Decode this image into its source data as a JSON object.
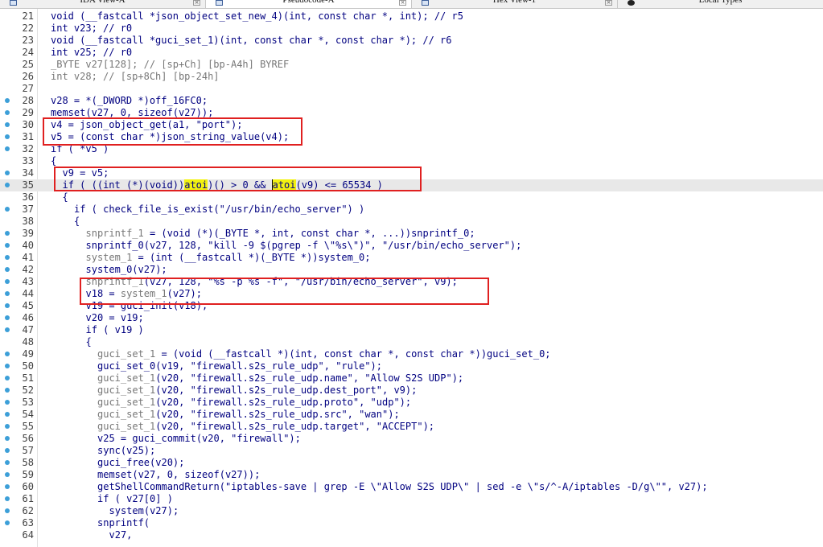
{
  "tabs": [
    {
      "label": "IDA View-A",
      "icon": "ida-view-icon",
      "active": false
    },
    {
      "label": "Pseudocode-A",
      "icon": "pseudocode-icon",
      "active": true
    },
    {
      "label": "Hex View-1",
      "icon": "hex-view-icon",
      "active": false
    },
    {
      "label": "Local Types",
      "icon": "local-types-icon",
      "active": false
    }
  ],
  "colors": {
    "highlight_box": "#e02020",
    "breakpoint_dot": "#3c9fd8",
    "text": "#000080",
    "grey": "#777777",
    "search_highlight": "#f2f210"
  },
  "lines": [
    {
      "num": "21",
      "bp": false,
      "indent": 0,
      "parts": [
        [
          "c",
          "void (__fastcall *json_object_set_new_4)(int, const char *, int); // r5"
        ]
      ]
    },
    {
      "num": "22",
      "bp": false,
      "indent": 0,
      "parts": [
        [
          "c",
          "int v23; // r0"
        ]
      ]
    },
    {
      "num": "23",
      "bp": false,
      "indent": 0,
      "parts": [
        [
          "c",
          "void (__fastcall *guci_set_1)(int, const char *, const char *); // r6"
        ]
      ]
    },
    {
      "num": "24",
      "bp": false,
      "indent": 0,
      "parts": [
        [
          "c",
          "int v25; // r0"
        ]
      ]
    },
    {
      "num": "25",
      "bp": false,
      "indent": 0,
      "parts": [
        [
          "g",
          "_BYTE v27[128]; // [sp+Ch] [bp-A4h] BYREF"
        ]
      ]
    },
    {
      "num": "26",
      "bp": false,
      "indent": 0,
      "parts": [
        [
          "g",
          "int v28; // [sp+8Ch] [bp-24h]"
        ]
      ]
    },
    {
      "num": "27",
      "bp": false,
      "indent": 0,
      "parts": [
        [
          "c",
          ""
        ]
      ]
    },
    {
      "num": "28",
      "bp": true,
      "indent": 0,
      "parts": [
        [
          "c",
          "v28 = *(_DWORD *)off_16FC0;"
        ]
      ]
    },
    {
      "num": "29",
      "bp": true,
      "indent": 0,
      "parts": [
        [
          "c",
          "memset(v27, 0, sizeof(v27));"
        ]
      ]
    },
    {
      "num": "30",
      "bp": true,
      "indent": 0,
      "parts": [
        [
          "c",
          "v4 = json_object_get(a1, \"port\");"
        ]
      ]
    },
    {
      "num": "31",
      "bp": true,
      "indent": 0,
      "parts": [
        [
          "c",
          "v5 = (const char *)json_string_value(v4);"
        ]
      ]
    },
    {
      "num": "32",
      "bp": true,
      "indent": 0,
      "parts": [
        [
          "c",
          "if ( *v5 )"
        ]
      ]
    },
    {
      "num": "33",
      "bp": false,
      "indent": 0,
      "parts": [
        [
          "c",
          "{"
        ]
      ]
    },
    {
      "num": "34",
      "bp": true,
      "indent": 1,
      "parts": [
        [
          "c",
          "v9 = v5;"
        ]
      ]
    },
    {
      "num": "35",
      "bp": true,
      "indent": 1,
      "current": true,
      "parts": [
        [
          "c",
          "if ( ((int (*)(void))"
        ],
        [
          "h",
          "atoi"
        ],
        [
          "c",
          ")() > 0 && "
        ],
        [
          "k",
          "atoi"
        ],
        [
          "c",
          "(v9) <= 65534 )"
        ]
      ]
    },
    {
      "num": "36",
      "bp": false,
      "indent": 1,
      "parts": [
        [
          "c",
          "{"
        ]
      ]
    },
    {
      "num": "37",
      "bp": true,
      "indent": 2,
      "parts": [
        [
          "c",
          "if ( check_file_is_exist(\"/usr/bin/echo_server\") )"
        ]
      ]
    },
    {
      "num": "38",
      "bp": false,
      "indent": 2,
      "parts": [
        [
          "c",
          "{"
        ]
      ]
    },
    {
      "num": "39",
      "bp": true,
      "indent": 3,
      "parts": [
        [
          "g",
          "snprintf_1"
        ],
        [
          "c",
          " = (void (*)(_BYTE *, int, const char *, ...))snprintf_0;"
        ]
      ]
    },
    {
      "num": "40",
      "bp": true,
      "indent": 3,
      "parts": [
        [
          "c",
          "snprintf_0(v27, 128, \"kill -9 $(pgrep -f \\\"%s\\\")\", \"/usr/bin/echo_server\");"
        ]
      ]
    },
    {
      "num": "41",
      "bp": true,
      "indent": 3,
      "parts": [
        [
          "g",
          "system_1"
        ],
        [
          "c",
          " = (int (__fastcall *)(_BYTE *))system_0;"
        ]
      ]
    },
    {
      "num": "42",
      "bp": true,
      "indent": 3,
      "parts": [
        [
          "c",
          "system_0(v27);"
        ]
      ]
    },
    {
      "num": "43",
      "bp": true,
      "indent": 3,
      "parts": [
        [
          "g",
          "snprintf_1"
        ],
        [
          "c",
          "(v27, 128, \"%s -p %s -f\", \"/usr/bin/echo_server\", v9);"
        ]
      ]
    },
    {
      "num": "44",
      "bp": true,
      "indent": 3,
      "parts": [
        [
          "c",
          "v18 = "
        ],
        [
          "g",
          "system_1"
        ],
        [
          "c",
          "(v27);"
        ]
      ]
    },
    {
      "num": "45",
      "bp": true,
      "indent": 3,
      "parts": [
        [
          "c",
          "v19 = guci_init(v18);"
        ]
      ]
    },
    {
      "num": "46",
      "bp": true,
      "indent": 3,
      "parts": [
        [
          "c",
          "v20 = v19;"
        ]
      ]
    },
    {
      "num": "47",
      "bp": true,
      "indent": 3,
      "parts": [
        [
          "c",
          "if ( v19 )"
        ]
      ]
    },
    {
      "num": "48",
      "bp": false,
      "indent": 3,
      "parts": [
        [
          "c",
          "{"
        ]
      ]
    },
    {
      "num": "49",
      "bp": true,
      "indent": 4,
      "parts": [
        [
          "g",
          "guci_set_1"
        ],
        [
          "c",
          " = (void (__fastcall *)(int, const char *, const char *))guci_set_0;"
        ]
      ]
    },
    {
      "num": "50",
      "bp": true,
      "indent": 4,
      "parts": [
        [
          "c",
          "guci_set_0(v19, \"firewall.s2s_rule_udp\", \"rule\");"
        ]
      ]
    },
    {
      "num": "51",
      "bp": true,
      "indent": 4,
      "parts": [
        [
          "g",
          "guci_set_1"
        ],
        [
          "c",
          "(v20, \"firewall.s2s_rule_udp.name\", \"Allow S2S UDP\");"
        ]
      ]
    },
    {
      "num": "52",
      "bp": true,
      "indent": 4,
      "parts": [
        [
          "g",
          "guci_set_1"
        ],
        [
          "c",
          "(v20, \"firewall.s2s_rule_udp.dest_port\", v9);"
        ]
      ]
    },
    {
      "num": "53",
      "bp": true,
      "indent": 4,
      "parts": [
        [
          "g",
          "guci_set_1"
        ],
        [
          "c",
          "(v20, \"firewall.s2s_rule_udp.proto\", \"udp\");"
        ]
      ]
    },
    {
      "num": "54",
      "bp": true,
      "indent": 4,
      "parts": [
        [
          "g",
          "guci_set_1"
        ],
        [
          "c",
          "(v20, \"firewall.s2s_rule_udp.src\", \"wan\");"
        ]
      ]
    },
    {
      "num": "55",
      "bp": true,
      "indent": 4,
      "parts": [
        [
          "g",
          "guci_set_1"
        ],
        [
          "c",
          "(v20, \"firewall.s2s_rule_udp.target\", \"ACCEPT\");"
        ]
      ]
    },
    {
      "num": "56",
      "bp": true,
      "indent": 4,
      "parts": [
        [
          "c",
          "v25 = guci_commit(v20, \"firewall\");"
        ]
      ]
    },
    {
      "num": "57",
      "bp": true,
      "indent": 4,
      "parts": [
        [
          "c",
          "sync(v25);"
        ]
      ]
    },
    {
      "num": "58",
      "bp": true,
      "indent": 4,
      "parts": [
        [
          "c",
          "guci_free(v20);"
        ]
      ]
    },
    {
      "num": "59",
      "bp": true,
      "indent": 4,
      "parts": [
        [
          "c",
          "memset(v27, 0, sizeof(v27));"
        ]
      ]
    },
    {
      "num": "60",
      "bp": true,
      "indent": 4,
      "parts": [
        [
          "c",
          "getShellCommandReturn(\"iptables-save | grep -E \\\"Allow S2S UDP\\\" | sed -e \\\"s/^-A/iptables -D/g\\\"\", v27);"
        ]
      ]
    },
    {
      "num": "61",
      "bp": true,
      "indent": 4,
      "parts": [
        [
          "c",
          "if ( v27[0] )"
        ]
      ]
    },
    {
      "num": "62",
      "bp": true,
      "indent": 5,
      "parts": [
        [
          "c",
          "system(v27);"
        ]
      ]
    },
    {
      "num": "63",
      "bp": true,
      "indent": 4,
      "parts": [
        [
          "c",
          "snprintf("
        ]
      ]
    },
    {
      "num": "64",
      "bp": false,
      "indent": 5,
      "parts": [
        [
          "c",
          "v27,"
        ]
      ]
    }
  ]
}
